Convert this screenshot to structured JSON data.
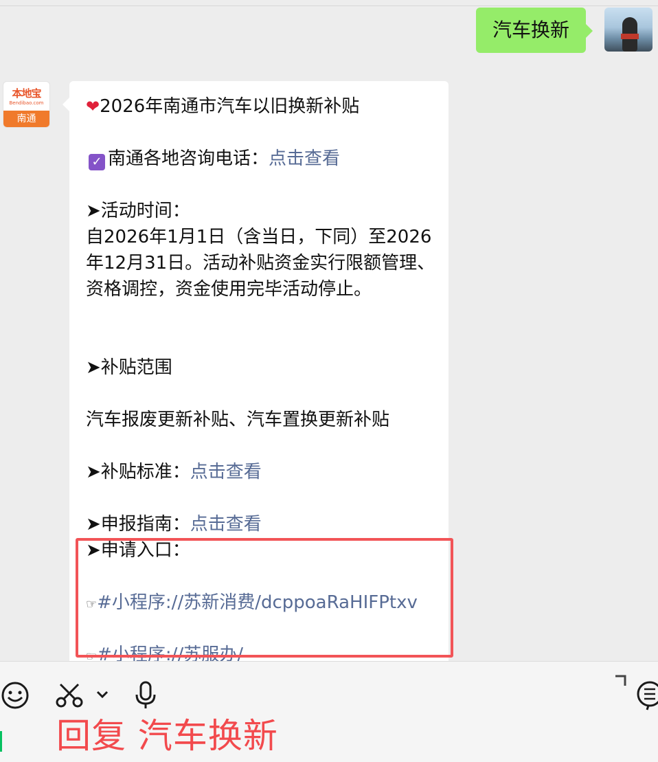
{
  "outgoing": {
    "text": "汽车换新"
  },
  "bot_avatar": {
    "logo": "本地宝",
    "sub": "Bendibao.com",
    "city": "南通"
  },
  "message": {
    "title": "2026年南通市汽车以旧换新补贴",
    "consult_label": "南通各地咨询电话：",
    "consult_link": "点击查看",
    "time_heading": "➤活动时间：",
    "time_body": "自2026年1月1日（含当日，下同）至2026年12月31日。活动补贴资金实行限额管理、资格调控，资金使用完毕活动停止。",
    "scope_heading": "➤补贴范围",
    "scope_body": "汽车报废更新补贴、汽车置换更新补贴",
    "standard_label": "➤补贴标准：",
    "standard_link": "点击查看",
    "guide_label": "➤申报指南：",
    "guide_link": "点击查看",
    "entry_heading": "➤申请入口：",
    "entry_link1": "#小程序://苏新消费/dcppoaRaHIFPtxv",
    "entry_link2": "#小程序://苏服办/"
  },
  "caption": "回复 汽车换新",
  "colors": {
    "accent_green": "#95ec69",
    "link": "#576b95",
    "highlight": "#f25457",
    "caption": "#f24a4d"
  }
}
